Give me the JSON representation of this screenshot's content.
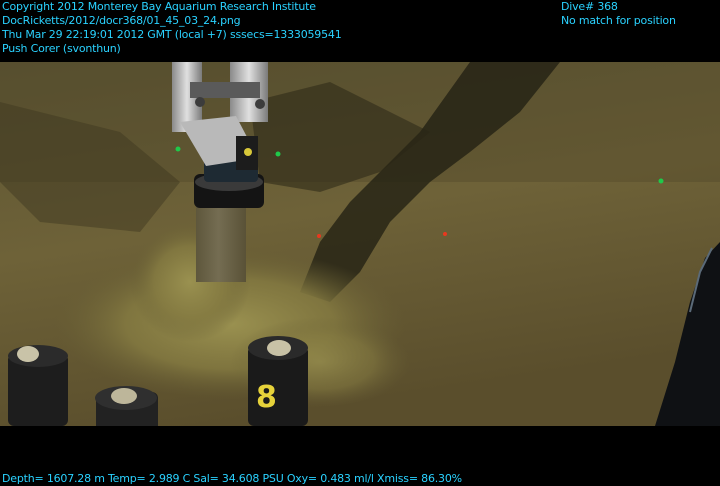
{
  "overlay": {
    "top_left_lines": [
      "Copyright 2012 Monterey Bay Aquarium Research Institute",
      "DocRicketts/2012/docr368/01_45_03_24.png",
      "Thu Mar 29 22:19:01 2012 GMT (local +7)  sssecs=1333059541",
      "Push Corer (svonthun)"
    ],
    "top_right_lines": [
      "Dive# 368",
      "No match for position"
    ],
    "footer": "Depth= 1607.28 m  Temp= 2.989 C  Sal= 34.608 PSU  Oxy= 0.483 ml/l  Xmiss= 86.30%",
    "text_color": "#2ad2ff"
  },
  "scene": {
    "core_tube_label": "8",
    "colors": {
      "sediment": "#6b5e34",
      "shadow": "#1e1c12",
      "sediment_cloud": "#8b8246",
      "lasers_green": "#1fc94a",
      "lasers_red": "#e8381e"
    }
  }
}
